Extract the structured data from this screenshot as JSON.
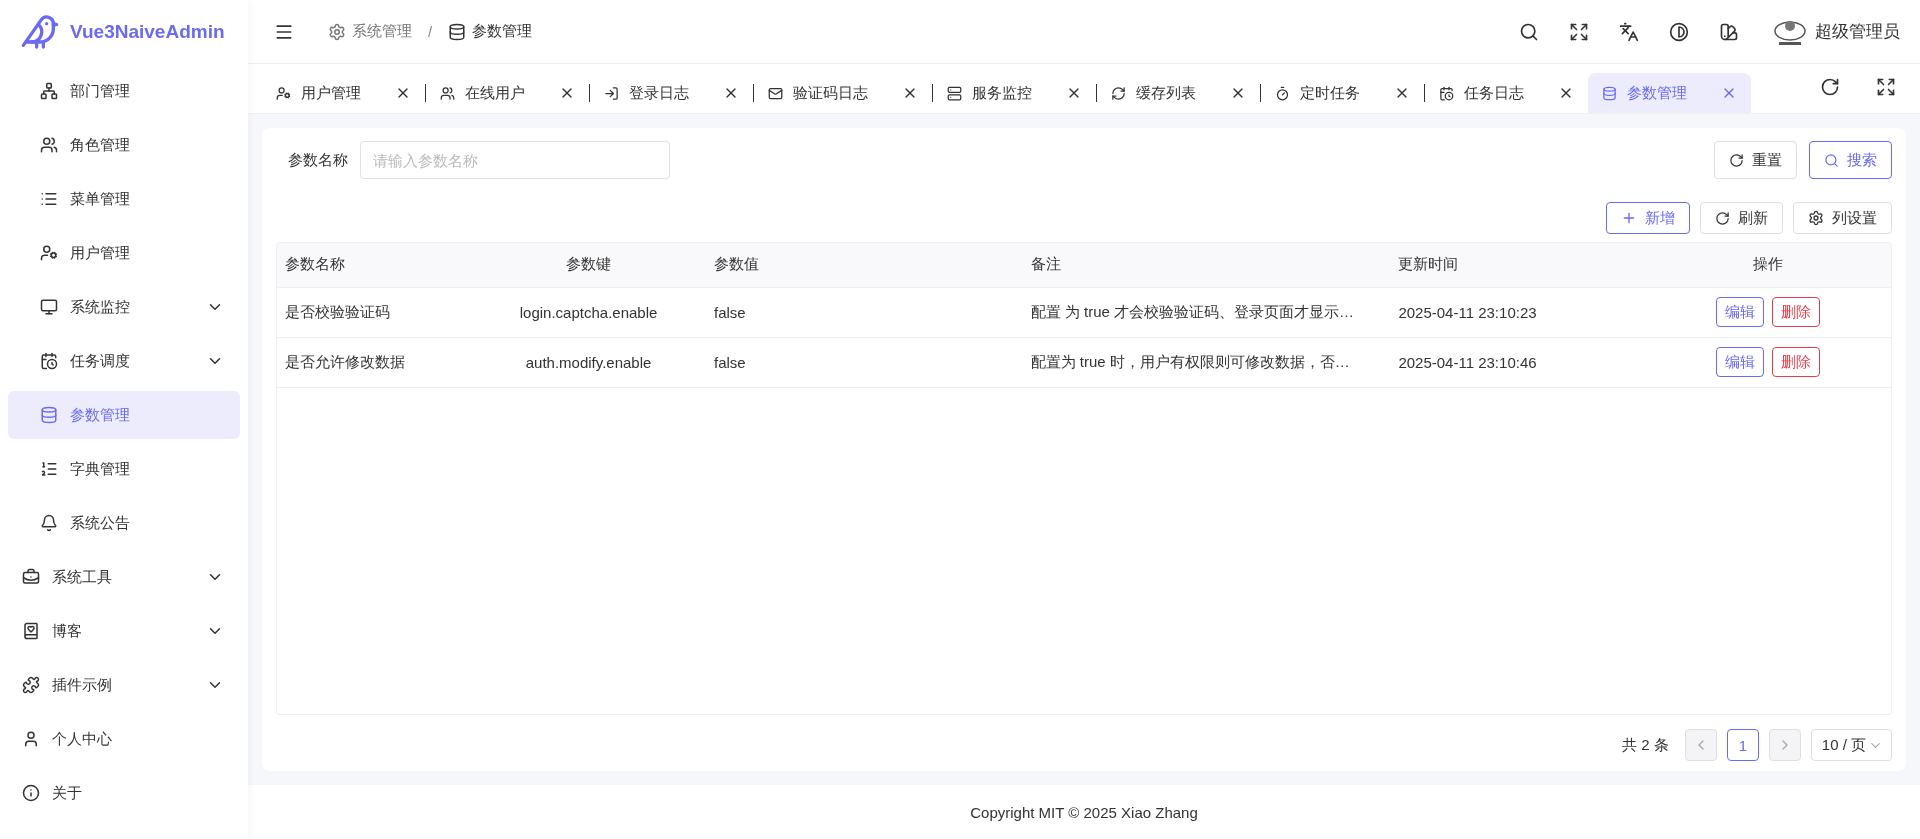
{
  "brand": {
    "name": "Vue3NaiveAdmin"
  },
  "breadcrumb": {
    "separator": "/",
    "items": [
      {
        "label": "系统管理"
      },
      {
        "label": "参数管理"
      }
    ]
  },
  "user": {
    "name": "超级管理员"
  },
  "sidebar": {
    "items": [
      {
        "label": "部门管理",
        "kind": "child",
        "expandable": false,
        "selected": false
      },
      {
        "label": "角色管理",
        "kind": "child",
        "expandable": false,
        "selected": false
      },
      {
        "label": "菜单管理",
        "kind": "child",
        "expandable": false,
        "selected": false
      },
      {
        "label": "用户管理",
        "kind": "child",
        "expandable": false,
        "selected": false
      },
      {
        "label": "系统监控",
        "kind": "child",
        "expandable": true,
        "selected": false
      },
      {
        "label": "任务调度",
        "kind": "child",
        "expandable": true,
        "selected": false
      },
      {
        "label": "参数管理",
        "kind": "child",
        "expandable": false,
        "selected": true
      },
      {
        "label": "字典管理",
        "kind": "child",
        "expandable": false,
        "selected": false
      },
      {
        "label": "系统公告",
        "kind": "child",
        "expandable": false,
        "selected": false
      },
      {
        "label": "系统工具",
        "kind": "root",
        "expandable": true,
        "selected": false
      },
      {
        "label": "博客",
        "kind": "root",
        "expandable": true,
        "selected": false
      },
      {
        "label": "插件示例",
        "kind": "root",
        "expandable": true,
        "selected": false
      },
      {
        "label": "个人中心",
        "kind": "root",
        "expandable": false,
        "selected": false
      },
      {
        "label": "关于",
        "kind": "root",
        "expandable": false,
        "selected": false
      }
    ]
  },
  "tabs": [
    {
      "label": "用户管理",
      "selected": false
    },
    {
      "label": "在线用户",
      "selected": false
    },
    {
      "label": "登录日志",
      "selected": false
    },
    {
      "label": "验证码日志",
      "selected": false
    },
    {
      "label": "服务监控",
      "selected": false
    },
    {
      "label": "缓存列表",
      "selected": false
    },
    {
      "label": "定时任务",
      "selected": false
    },
    {
      "label": "任务日志",
      "selected": false
    },
    {
      "label": "参数管理",
      "selected": true
    }
  ],
  "search": {
    "label": "参数名称",
    "placeholder": "请输入参数名称",
    "reset": "重置",
    "submit": "搜索"
  },
  "toolbar": {
    "add": "新增",
    "refresh": "刷新",
    "columns": "列设置"
  },
  "table": {
    "columns": [
      "参数名称",
      "参数键",
      "参数值",
      "备注",
      "更新时间",
      "操作"
    ],
    "rows": [
      {
        "cells": [
          "是否校验验证码",
          "login.captcha.enable",
          "false",
          "配置 为 true 才会校验验证码、登录页面才显示…",
          "2025-04-11 23:10:23"
        ],
        "actions": [
          "编辑",
          "删除"
        ]
      },
      {
        "cells": [
          "是否允许修改数据",
          "auth.modify.enable",
          "false",
          "配置为 true 时，用户有权限则可修改数据，否…",
          "2025-04-11 23:10:46"
        ],
        "actions": [
          "编辑",
          "删除"
        ]
      }
    ]
  },
  "pagination": {
    "total": "共 2 条",
    "pages": [
      {
        "label": "1",
        "selected": true
      }
    ],
    "page_size": "10 / 页"
  },
  "footer": "Copyright MIT © 2025 Xiao Zhang"
}
